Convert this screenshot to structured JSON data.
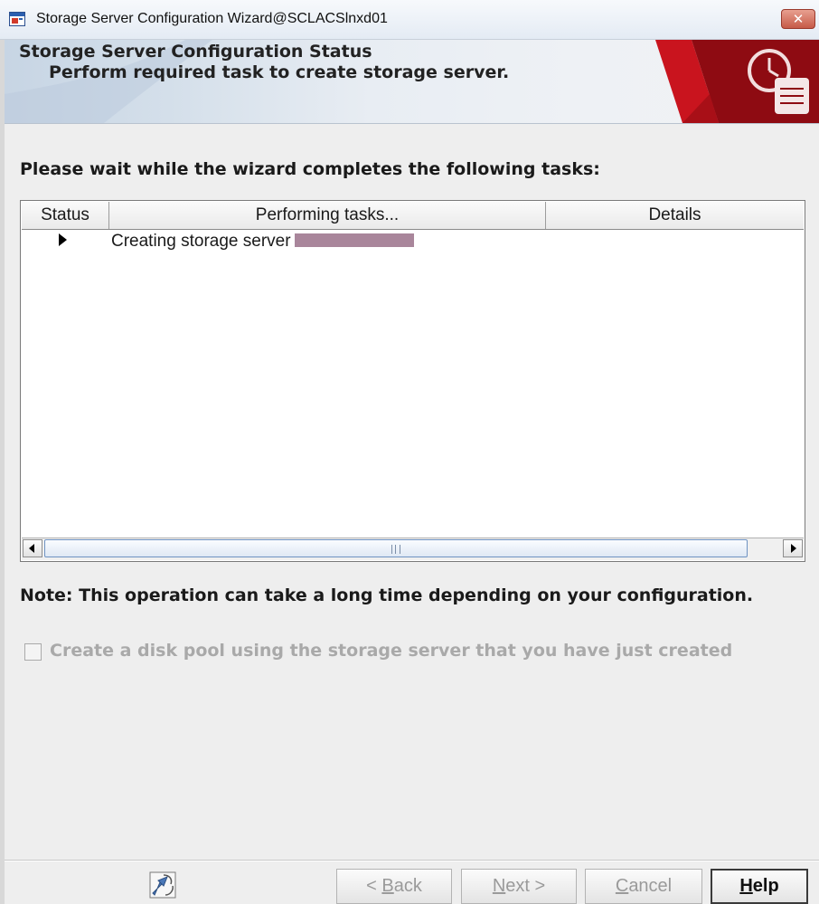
{
  "window": {
    "title": "Storage Server Configuration Wizard@SCLACSlnxd01",
    "close_label": "✕"
  },
  "banner": {
    "title": "Storage Server Configuration Status",
    "subtitle": "Perform required task to create storage server.",
    "logo_icon": "clock-scroll-icon",
    "accent_color": "#b5121b"
  },
  "main": {
    "instruction": "Please wait while the wizard completes the following tasks:",
    "table": {
      "columns": [
        "Status",
        "Performing tasks...",
        "Details"
      ],
      "rows": [
        {
          "status_icon": "play-arrow-icon",
          "task": "Creating storage server",
          "details": ""
        }
      ]
    },
    "note": "Note: This operation can take a long time depending on your configuration.",
    "checkbox": {
      "label": "Create a disk pool using the storage server that you have just created",
      "checked": false,
      "enabled": false
    }
  },
  "footer": {
    "icon": "wizard-help-icon",
    "buttons": {
      "back": {
        "pre": "< ",
        "mnemonic": "B",
        "post": "ack",
        "enabled": false
      },
      "next": {
        "pre": "",
        "mnemonic": "N",
        "post": "ext >",
        "enabled": false
      },
      "cancel": {
        "pre": "",
        "mnemonic": "C",
        "post": "ancel",
        "enabled": false
      },
      "help": {
        "pre": "",
        "mnemonic": "H",
        "post": "elp",
        "enabled": true
      }
    }
  }
}
